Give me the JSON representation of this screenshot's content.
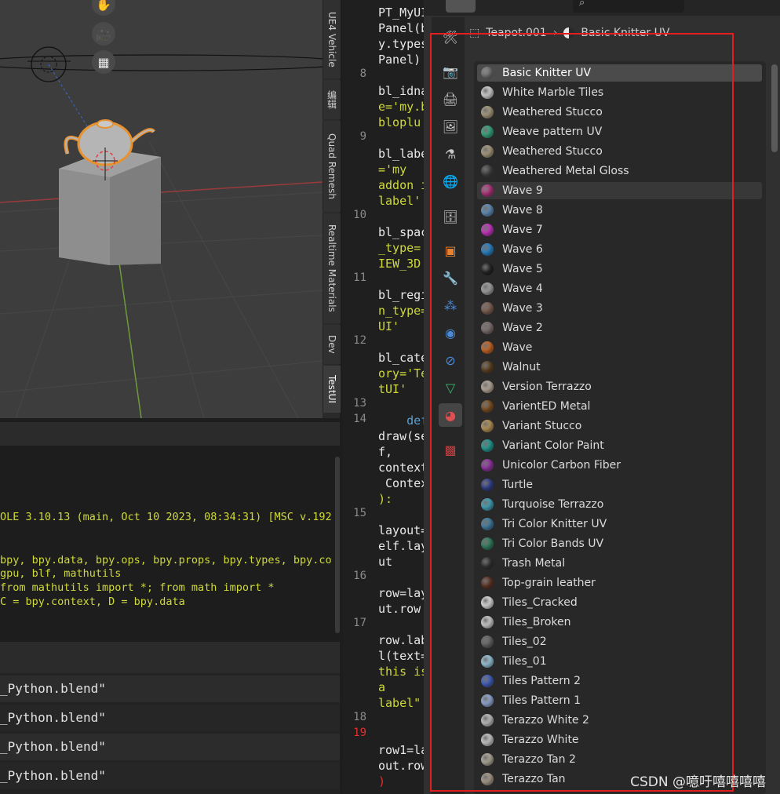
{
  "viewport": {
    "tools": [
      "hand-icon",
      "camera-icon",
      "grid-icon"
    ]
  },
  "side_tabs": [
    "UE4 Vehicle",
    "编辑",
    "Quad Remesh",
    "Realtime Materials",
    "Dev",
    "TestUI"
  ],
  "console": {
    "lines": [
      "OLE 3.10.13 (main, Oct 10 2023, 08:34:31) [MSC v.192",
      "bpy, bpy.data, bpy.ops, bpy.props, bpy.types, bpy.co",
      "gpu, blf, mathutils",
      "from mathutils import *; from math import *",
      "C = bpy.context, D = bpy.data"
    ]
  },
  "info": {
    "rows": [
      "_Python.blend\"",
      "_Python.blend\"",
      "_Python.blend\"",
      "_Python.blend\""
    ]
  },
  "code": {
    "line_numbers": [
      "8",
      "9",
      "10",
      "11",
      "12",
      "13",
      "14",
      "15",
      "16",
      "17",
      "18",
      "19"
    ],
    "lines": [
      "PT_MyUI",
      "Panel(b",
      "y.types",
      "Panel)",
      "bl_idna",
      "e='my.b",
      "bloplu",
      "bl_labe",
      "='my",
      "addon i",
      "label'",
      "bl_spac",
      "_type=",
      "IEW_3D",
      "bl_regi",
      "n_type=",
      "UI'",
      "bl_cate",
      "ory='Te",
      "tUI'",
      "    def",
      "draw(se",
      "f,",
      "context",
      " Contex",
      "):",
      "layout=",
      "elf.lay",
      "ut",
      "row=lay",
      "ut.row",
      "row.lab",
      "l(text=",
      "this is",
      "a",
      "label\"",
      "row1=la",
      "out.row",
      ")"
    ]
  },
  "properties": {
    "breadcrumb_object": "Teapot.001",
    "breadcrumb_material": "Basic Knitter UV",
    "tab_icons": [
      "tool-icon",
      "render-icon",
      "output-icon",
      "view-layer-icon",
      "scene-icon",
      "world-icon",
      "collection-icon",
      "object-icon",
      "modifier-icon",
      "particles-icon",
      "physics-icon",
      "constraints-icon",
      "data-icon",
      "material-icon",
      "texture-icon"
    ],
    "materials": [
      {
        "name": "Basic Knitter UV",
        "color": "#7a7a7a"
      },
      {
        "name": "White Marble Tiles",
        "color": "#e6e6e6"
      },
      {
        "name": "Weathered Stucco",
        "color": "#b8a98a"
      },
      {
        "name": "Weave pattern UV",
        "color": "#3fb58a"
      },
      {
        "name": "Weathered Stucco",
        "color": "#b8a98a"
      },
      {
        "name": "Weathered Metal Gloss",
        "color": "#4a4a4a"
      },
      {
        "name": "Wave 9",
        "color": "#c23a8a"
      },
      {
        "name": "Wave 8",
        "color": "#6a9ac8"
      },
      {
        "name": "Wave 7",
        "color": "#d83bd0"
      },
      {
        "name": "Wave 6",
        "color": "#2f8fd8"
      },
      {
        "name": "Wave 5",
        "color": "#2a2a2a"
      },
      {
        "name": "Wave 4",
        "color": "#b0b0b0"
      },
      {
        "name": "Wave 3",
        "color": "#8a6a5a"
      },
      {
        "name": "Wave 2",
        "color": "#8a7a7a"
      },
      {
        "name": "Wave",
        "color": "#d8702a"
      },
      {
        "name": "Walnut",
        "color": "#6a4a2a"
      },
      {
        "name": "Version Terrazzo",
        "color": "#c8b8a8"
      },
      {
        "name": "VarientED Metal",
        "color": "#8a5a2a"
      },
      {
        "name": "Variant Stucco",
        "color": "#c8a060"
      },
      {
        "name": "Variant Color Paint",
        "color": "#2aa8a0"
      },
      {
        "name": "Unicolor Carbon Fiber",
        "color": "#a03ab0"
      },
      {
        "name": "Turtle",
        "color": "#3a4a9a"
      },
      {
        "name": "Turquoise Terrazzo",
        "color": "#4ab0c8"
      },
      {
        "name": "Tri Color Knitter UV",
        "color": "#4a8ab0"
      },
      {
        "name": "Tri Color Bands UV",
        "color": "#3a8a6a"
      },
      {
        "name": "Trash Metal",
        "color": "#3a3a3a"
      },
      {
        "name": "Top-grain leather",
        "color": "#6a3a2a"
      },
      {
        "name": "Tiles_Cracked",
        "color": "#f0f0f0"
      },
      {
        "name": "Tiles_Broken",
        "color": "#e0e0e0"
      },
      {
        "name": "Tiles_02",
        "color": "#707070"
      },
      {
        "name": "Tiles_01",
        "color": "#a8d8f0"
      },
      {
        "name": "Tiles Pattern 2",
        "color": "#4a6ad0"
      },
      {
        "name": "Tiles Pattern 1",
        "color": "#a0b8e8"
      },
      {
        "name": "Terazzo White 2",
        "color": "#d0d0d0"
      },
      {
        "name": "Terazzo White",
        "color": "#dadada"
      },
      {
        "name": "Terazzo Tan 2",
        "color": "#c0b8a8"
      },
      {
        "name": "Terazzo Tan",
        "color": "#b8aa98"
      }
    ]
  },
  "watermark": "CSDN @噫吁嘻嘻嘻嘻"
}
